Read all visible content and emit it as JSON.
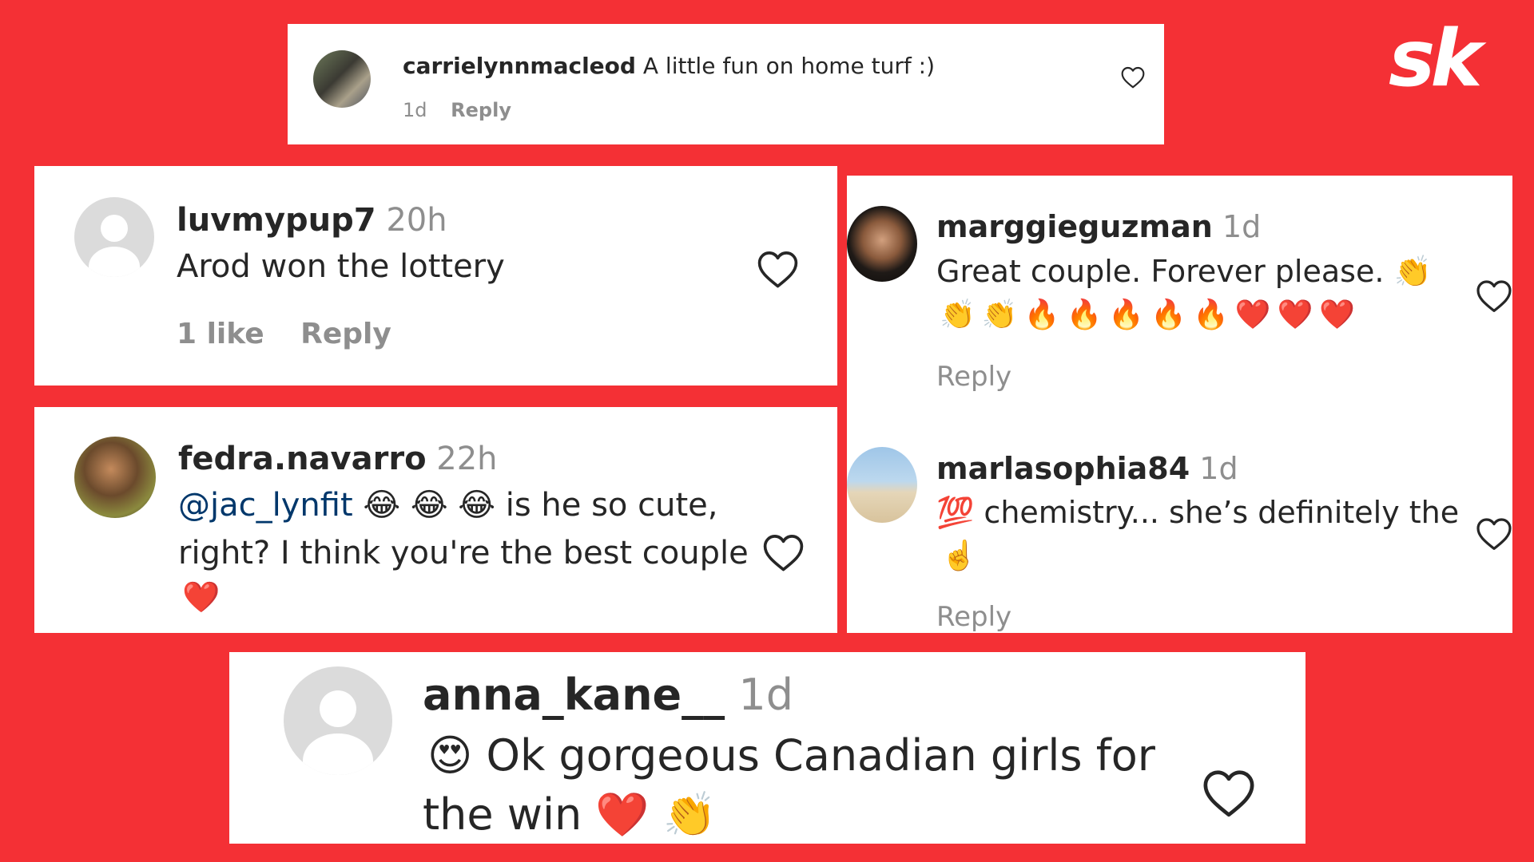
{
  "brand": {
    "logo_text": "sk"
  },
  "colors": {
    "background": "#f43035",
    "card": "#ffffff",
    "mention": "#00376b",
    "muted": "#8e8e8e"
  },
  "comments": [
    {
      "username": "carrielynnmacleod",
      "time": "",
      "text": "A little fun on home turf :)",
      "meta_time": "1d",
      "reply": "Reply",
      "avatar": "photo-two-women"
    },
    {
      "username": "luvmypup7",
      "time": "20h",
      "text": "Arod won the lottery",
      "likes": "1 like",
      "reply": "Reply",
      "avatar": "default-avatar-icon"
    },
    {
      "username": "fedra.navarro",
      "time": "22h",
      "mention": "@jac_lynfit",
      "emojis_1": "😂 😂 😂",
      "text_1": "is he so cute,",
      "text_2": "right? I think you're the best couple",
      "emojis_2": "❤️",
      "avatar": "photo-woman"
    },
    {
      "username": "marggieguzman",
      "time": "1d",
      "text": "Great couple. Forever please.",
      "emojis_1": "👏",
      "emojis_2": "👏👏🔥🔥🔥🔥🔥❤️❤️❤️",
      "reply": "Reply",
      "avatar": "photo-woman-dark-hair"
    },
    {
      "username": "marlasophia84",
      "time": "1d",
      "emojis_1": "💯",
      "text": "chemistry... she’s definitely the",
      "emojis_2": "☝️",
      "reply": "Reply",
      "avatar": "photo-beach"
    },
    {
      "username": "anna_kane__",
      "time": "1d",
      "emojis_1": "😍",
      "text_1": "Ok gorgeous Canadian girls for",
      "text_2": "the win",
      "emojis_2": "❤️ 👏",
      "avatar": "default-avatar-icon"
    }
  ]
}
